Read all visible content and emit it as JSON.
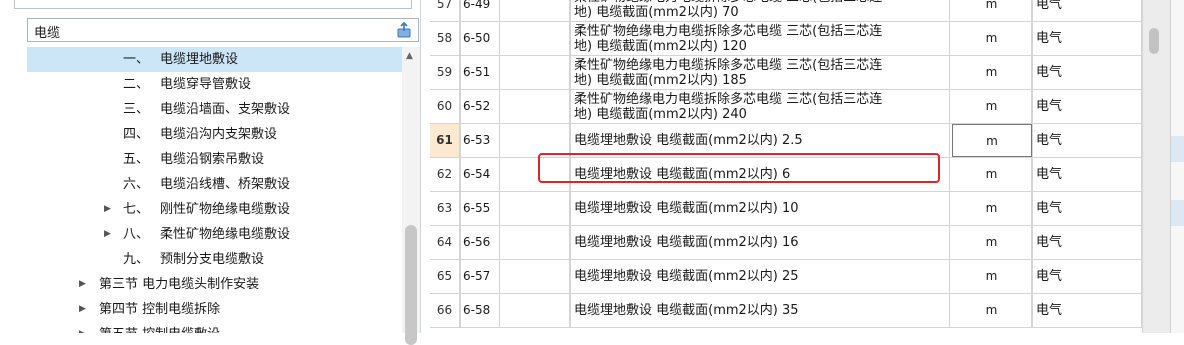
{
  "search": {
    "value": "电缆"
  },
  "tree": {
    "items": [
      {
        "num": "一、",
        "label": "电缆埋地敷设",
        "selected": true
      },
      {
        "num": "二、",
        "label": "电缆穿导管敷设"
      },
      {
        "num": "三、",
        "label": "电缆沿墙面、支架敷设"
      },
      {
        "num": "四、",
        "label": "电缆沿沟内支架敷设"
      },
      {
        "num": "五、",
        "label": "电缆沿钢索吊敷设"
      },
      {
        "num": "六、",
        "label": "电缆沿线槽、桥架敷设"
      },
      {
        "num": "七、",
        "label": "刚性矿物绝缘电缆敷设",
        "expandable": true
      },
      {
        "num": "八、",
        "label": "柔性矿物绝缘电缆敷设",
        "expandable": true
      },
      {
        "num": "九、",
        "label": "预制分支电缆敷设"
      }
    ],
    "sections": [
      {
        "label": "第三节 电力电缆头制作安装"
      },
      {
        "label": "第四节 控制电缆拆除"
      },
      {
        "label": "第五节 控制电缆敷设"
      }
    ]
  },
  "grid": {
    "rows": [
      {
        "idx": "57",
        "code": "6-49",
        "name1": "柔性矿物绝缘电力电缆拆除多芯电缆 三芯(包括三芯连",
        "name2": "地) 电缆截面(mm2以内) 70",
        "unit": "m",
        "cat": "电气"
      },
      {
        "idx": "58",
        "code": "6-50",
        "name1": "柔性矿物绝缘电力电缆拆除多芯电缆 三芯(包括三芯连",
        "name2": "地) 电缆截面(mm2以内) 120",
        "unit": "m",
        "cat": "电气"
      },
      {
        "idx": "59",
        "code": "6-51",
        "name1": "柔性矿物绝缘电力电缆拆除多芯电缆 三芯(包括三芯连",
        "name2": "地) 电缆截面(mm2以内) 185",
        "unit": "m",
        "cat": "电气"
      },
      {
        "idx": "60",
        "code": "6-52",
        "name1": "柔性矿物绝缘电力电缆拆除多芯电缆 三芯(包括三芯连",
        "name2": "地) 电缆截面(mm2以内) 240",
        "unit": "m",
        "cat": "电气"
      },
      {
        "idx": "61",
        "code": "6-53",
        "name1": "电缆埋地敷设 电缆截面(mm2以内) 2.5",
        "name2": "",
        "unit": "m",
        "cat": "电气",
        "current": true
      },
      {
        "idx": "62",
        "code": "6-54",
        "name1": "电缆埋地敷设 电缆截面(mm2以内) 6",
        "name2": "",
        "unit": "m",
        "cat": "电气"
      },
      {
        "idx": "63",
        "code": "6-55",
        "name1": "电缆埋地敷设 电缆截面(mm2以内) 10",
        "name2": "",
        "unit": "m",
        "cat": "电气"
      },
      {
        "idx": "64",
        "code": "6-56",
        "name1": "电缆埋地敷设 电缆截面(mm2以内) 16",
        "name2": "",
        "unit": "m",
        "cat": "电气"
      },
      {
        "idx": "65",
        "code": "6-57",
        "name1": "电缆埋地敷设 电缆截面(mm2以内) 25",
        "name2": "",
        "unit": "m",
        "cat": "电气"
      },
      {
        "idx": "66",
        "code": "6-58",
        "name1": "电缆埋地敷设 电缆截面(mm2以内) 35",
        "name2": "",
        "unit": "m",
        "cat": "电气"
      }
    ]
  },
  "colors": {
    "selection": "#cde6f7",
    "highlight": "#e0242a",
    "current_index": "#fde9d0"
  }
}
